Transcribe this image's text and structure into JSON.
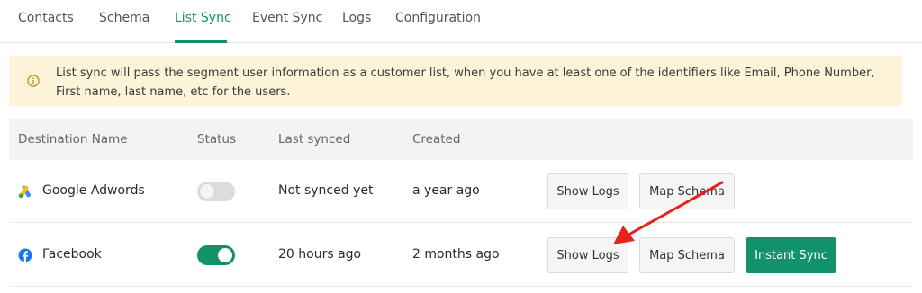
{
  "tabs": [
    {
      "label": "Contacts",
      "active": false
    },
    {
      "label": "Schema",
      "active": false
    },
    {
      "label": "List Sync",
      "active": true
    },
    {
      "label": "Event Sync",
      "active": false
    },
    {
      "label": "Logs",
      "active": false
    },
    {
      "label": "Configuration",
      "active": false
    }
  ],
  "banner": {
    "icon": "info-icon",
    "text": "List sync will pass the segment user information as a customer list, when you have at least one of the identifiers like Email, Phone Number, First name, last name, etc for the users."
  },
  "table": {
    "headers": [
      "Destination Name",
      "Status",
      "Last synced",
      "Created"
    ],
    "rows": [
      {
        "name": "Google Adwords",
        "logo": "google-ads-logo-icon",
        "status_on": false,
        "last_synced": "Not synced yet",
        "created": "a year ago",
        "actions": [
          "Show Logs",
          "Map Schema"
        ]
      },
      {
        "name": "Facebook",
        "logo": "facebook-logo-icon",
        "status_on": true,
        "last_synced": "20 hours ago",
        "created": "2 months ago",
        "actions": [
          "Show Logs",
          "Map Schema",
          "Instant Sync"
        ]
      }
    ]
  },
  "colors": {
    "accent": "#12926a",
    "banner_bg": "#fdf3d8",
    "annotation_arrow": "#e8221b"
  }
}
